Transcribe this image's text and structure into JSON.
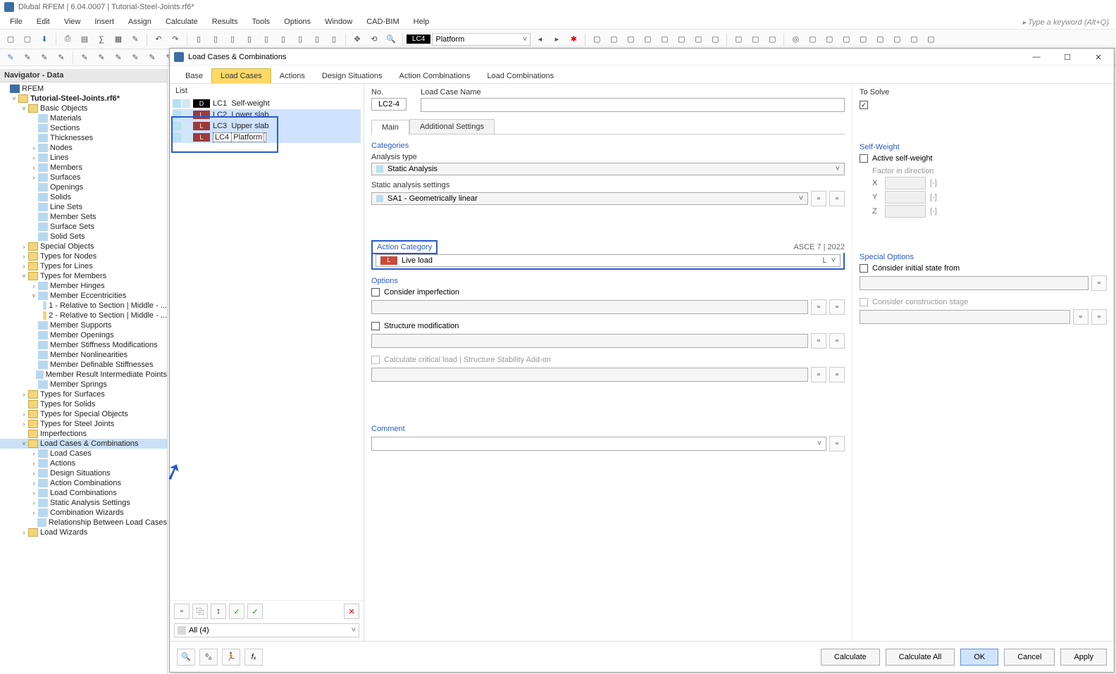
{
  "app": {
    "title": "Dlubal RFEM | 6.04.0007 | Tutorial-Steel-Joints.rf6*"
  },
  "menu": {
    "items": [
      "File",
      "Edit",
      "View",
      "Insert",
      "Assign",
      "Calculate",
      "Results",
      "Tools",
      "Options",
      "Window",
      "CAD-BIM",
      "Help"
    ]
  },
  "search": {
    "placeholder": "Type a keyword (Alt+Q)"
  },
  "toolbar": {
    "lc_badge": "LC4",
    "lc_name": "Platform"
  },
  "navigator": {
    "title": "Navigator - Data",
    "root": "RFEM",
    "project": "Tutorial-Steel-Joints.rf6*",
    "basic_objects": {
      "label": "Basic Objects",
      "children": [
        "Materials",
        "Sections",
        "Thicknesses",
        "Nodes",
        "Lines",
        "Members",
        "Surfaces",
        "Openings",
        "Solids",
        "Line Sets",
        "Member Sets",
        "Surface Sets",
        "Solid Sets"
      ]
    },
    "special_objects": "Special Objects",
    "types_nodes": "Types for Nodes",
    "types_lines": "Types for Lines",
    "types_members": {
      "label": "Types for Members",
      "children": [
        "Member Hinges",
        "Member Eccentricities",
        "Member Supports",
        "Member Openings",
        "Member Stiffness Modifications",
        "Member Nonlinearities",
        "Member Definable Stiffnesses",
        "Member Result Intermediate Points",
        "Member Springs"
      ],
      "ecc_children": [
        "1 - Relative to Section | Middle - ...",
        "2 - Relative to Section | Middle - ..."
      ]
    },
    "types_surfaces": "Types for Surfaces",
    "types_solids": "Types for Solids",
    "types_special": "Types for Special Objects",
    "types_steel": "Types for Steel Joints",
    "imperfections": "Imperfections",
    "lcc": {
      "label": "Load Cases & Combinations",
      "children": [
        "Load Cases",
        "Actions",
        "Design Situations",
        "Action Combinations",
        "Load Combinations",
        "Static Analysis Settings",
        "Combination Wizards",
        "Relationship Between Load Cases"
      ]
    },
    "load_wizards": "Load Wizards"
  },
  "dialog": {
    "title": "Load Cases & Combinations",
    "tabs": [
      "Base",
      "Load Cases",
      "Actions",
      "Design Situations",
      "Action Combinations",
      "Load Combinations"
    ],
    "active_tab": 1,
    "list": {
      "header": "List",
      "rows": [
        {
          "badge": "D",
          "badge_class": "d",
          "id": "LC1",
          "name": "Self-weight"
        },
        {
          "badge": "L",
          "badge_class": "l",
          "id": "LC2",
          "name": "Lower slab"
        },
        {
          "badge": "L",
          "badge_class": "l",
          "id": "LC3",
          "name": "Upper slab"
        },
        {
          "badge": "L",
          "badge_class": "l",
          "id": "LC4",
          "name": "Platform",
          "editing": true
        }
      ],
      "filter": "All (4)"
    },
    "form": {
      "no_label": "No.",
      "no_value": "LC2-4",
      "name_label": "Load Case Name",
      "name_value": "",
      "to_solve": "To Solve",
      "sub_tabs": [
        "Main",
        "Additional Settings"
      ],
      "categories": "Categories",
      "analysis_type_label": "Analysis type",
      "analysis_type": "Static Analysis",
      "sas_label": "Static analysis settings",
      "sas_value": "SA1 - Geometrically linear",
      "action_category": "Action Category",
      "asce": "ASCE 7 | 2022",
      "action_value": "Live load",
      "action_code": "L",
      "self_weight": "Self-Weight",
      "active_sw": "Active self-weight",
      "factor_dir": "Factor in direction",
      "axes": [
        "X",
        "Y",
        "Z"
      ],
      "unit": "[-]",
      "options": "Options",
      "consider_imperf": "Consider imperfection",
      "structure_mod": "Structure modification",
      "calc_crit": "Calculate critical load | Structure Stability Add-on",
      "special_options": "Special Options",
      "initial_state": "Consider initial state from",
      "construction_stage": "Consider construction stage",
      "comment": "Comment"
    },
    "buttons": {
      "calculate": "Calculate",
      "calculate_all": "Calculate All",
      "ok": "OK",
      "cancel": "Cancel",
      "apply": "Apply"
    }
  }
}
